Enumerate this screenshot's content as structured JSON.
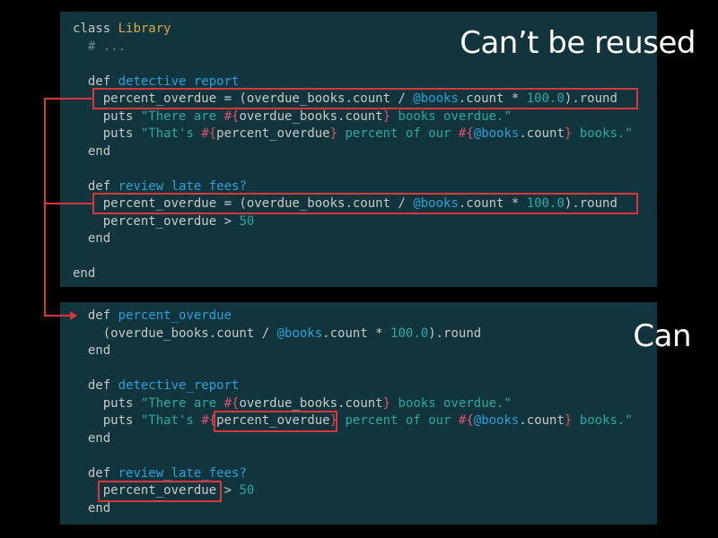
{
  "captions": {
    "top": "Can’t be reused",
    "bottom": "Can"
  },
  "top_code": {
    "l1_kw": "class",
    "l1_const": "Library",
    "l2_comment": "# ...",
    "l4_kw": "def",
    "l4_name": "detective_report",
    "l5_a": "percent_overdue = (overdue_books.count / ",
    "l5_ivar": "@books",
    "l5_b": ".count * ",
    "l5_num": "100.0",
    "l5_c": ").round",
    "l6_a": "puts ",
    "l6_s1": "\"There are ",
    "l6_i1": "#{",
    "l6_m": "overdue_books.count",
    "l6_i2": "}",
    "l6_s2": " books overdue.\"",
    "l7_a": "puts ",
    "l7_s1": "\"That's ",
    "l7_i1": "#{",
    "l7_m": "percent_overdue",
    "l7_i2": "}",
    "l7_s2": " percent of our ",
    "l7_i3": "#{",
    "l7_ivar": "@books",
    "l7_m2": ".count",
    "l7_i4": "}",
    "l7_s3": " books.\"",
    "l8": "end",
    "l10_kw": "def",
    "l10_name": "review_late_fees?",
    "l11_a": "percent_overdue = (overdue_books.count / ",
    "l11_ivar": "@books",
    "l11_b": ".count * ",
    "l11_num": "100.0",
    "l11_c": ").round",
    "l12_a": "percent_overdue > ",
    "l12_num": "50",
    "l13": "end",
    "l15": "end"
  },
  "bottom_code": {
    "l1_kw": "def",
    "l1_name": "percent_overdue",
    "l2_a": "(overdue_books.count / ",
    "l2_ivar": "@books",
    "l2_b": ".count * ",
    "l2_num": "100.0",
    "l2_c": ").round",
    "l3": "end",
    "l5_kw": "def",
    "l5_name": "detective_report",
    "l6_a": "puts ",
    "l6_s1": "\"There are ",
    "l6_i1": "#{",
    "l6_m": "overdue_books.count",
    "l6_i2": "}",
    "l6_s2": " books overdue.\"",
    "l7_a": "puts ",
    "l7_s1": "\"That's ",
    "l7_i1": "#{",
    "l7_m": "percent_overdue",
    "l7_i2": "}",
    "l7_s2": " percent of our ",
    "l7_i3": "#{",
    "l7_ivar": "@books",
    "l7_m2": ".count",
    "l7_i4": "}",
    "l7_s3": " books.\"",
    "l8": "end",
    "l10_kw": "def",
    "l10_name": "review_late_fees?",
    "l11_a": "percent_overdue",
    "l11_b": " > ",
    "l11_num": "50",
    "l12": "end"
  },
  "colors": {
    "panel_bg": "#11343d",
    "highlight": "#d9363e",
    "keyword_fn": "#2aa1d8",
    "constant": "#d7a94a",
    "string": "#2aa9a0",
    "interp": "#e0506a"
  }
}
